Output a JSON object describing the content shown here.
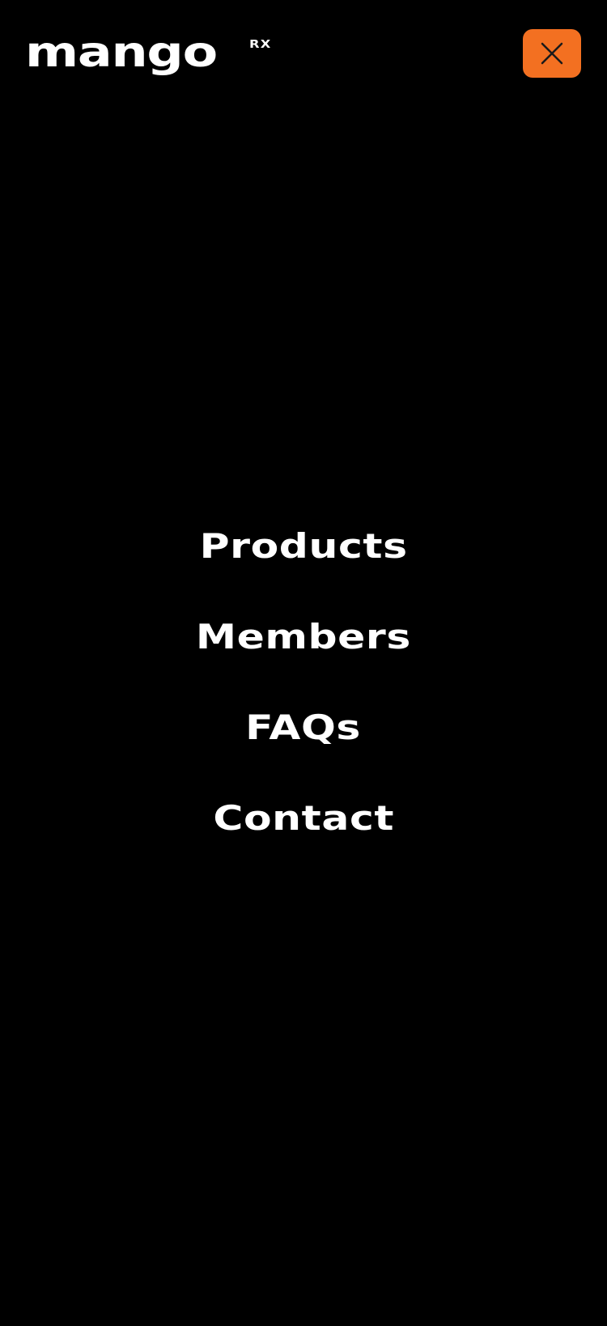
{
  "brand": {
    "name": "mango",
    "suffix": "RX",
    "leaf_icon": "leaf-icon"
  },
  "header": {
    "close_icon": "close-icon"
  },
  "nav": {
    "items": [
      {
        "label": "Products"
      },
      {
        "label": "Members"
      },
      {
        "label": "FAQs"
      },
      {
        "label": "Contact"
      }
    ]
  },
  "colors": {
    "background": "#000000",
    "text": "#ffffff",
    "accent": "#f37021",
    "icon_stroke": "#1a1a1a"
  }
}
